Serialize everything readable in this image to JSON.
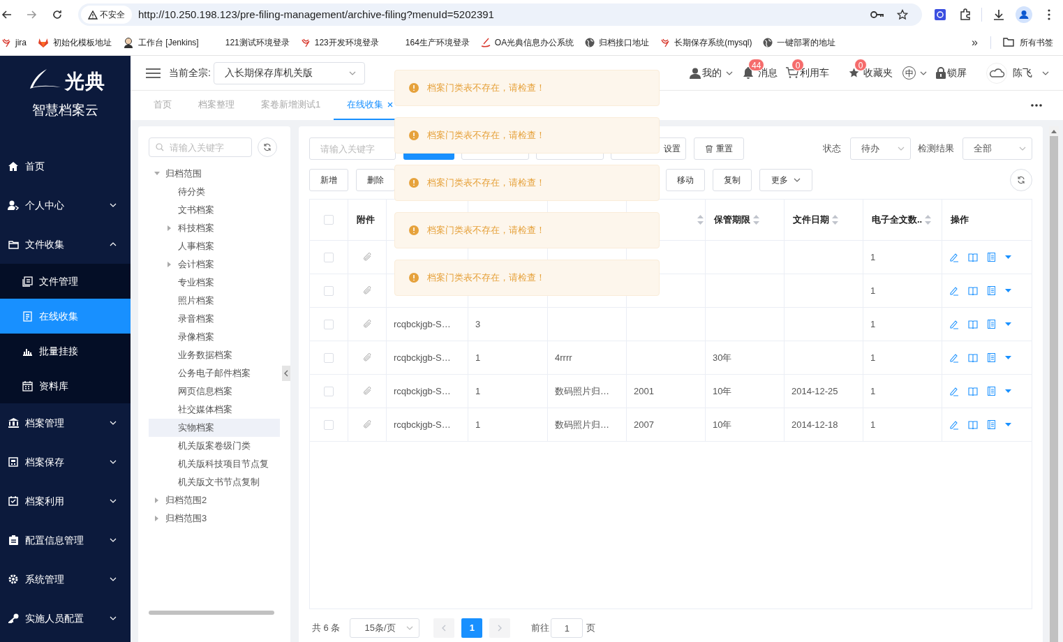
{
  "browser": {
    "security_label": "不安全",
    "url": "http://10.250.198.123/pre-filing-management/archive-filing?menuId=5202391",
    "bookmarks": [
      {
        "label": "jira"
      },
      {
        "label": "初始化模板地址"
      },
      {
        "label": "工作台 [Jenkins]"
      },
      {
        "label": "121测试环境登录"
      },
      {
        "label": "123开发环境登录"
      },
      {
        "label": "164生产环境登录"
      },
      {
        "label": "OA光典信息办公系统"
      },
      {
        "label": "归档接口地址"
      },
      {
        "label": "长期保存系统(mysql)"
      },
      {
        "label": "一键部署的地址"
      }
    ],
    "more": "»",
    "all_bookmarks": "所有书签"
  },
  "sidebar": {
    "logo_text": "光典",
    "subtitle": "智慧档案云",
    "menu": [
      {
        "label": "首页",
        "selected": false
      },
      {
        "label": "个人中心",
        "expanded": false,
        "selected": false
      },
      {
        "label": "文件收集",
        "expanded": true,
        "selected": false,
        "children": [
          {
            "label": "文件管理",
            "selected": false
          },
          {
            "label": "在线收集",
            "selected": true
          },
          {
            "label": "批量挂接",
            "selected": false
          },
          {
            "label": "资料库",
            "selected": false
          }
        ]
      },
      {
        "label": "档案管理",
        "expanded": false,
        "selected": false
      },
      {
        "label": "档案保存",
        "expanded": false,
        "selected": false
      },
      {
        "label": "档案利用",
        "expanded": false,
        "selected": false
      },
      {
        "label": "配置信息管理",
        "expanded": false,
        "selected": false
      },
      {
        "label": "系统管理",
        "expanded": false,
        "selected": false
      },
      {
        "label": "实施人员配置",
        "expanded": false,
        "selected": false
      }
    ]
  },
  "header": {
    "fonds_label": "当前全宗:",
    "fonds_value": "入长期保存库机关版",
    "items": [
      {
        "label": "我的"
      },
      {
        "label": "消息",
        "badge": "44"
      },
      {
        "label": "利用车",
        "badge": "0"
      },
      {
        "label": "收藏夹",
        "badge": "0"
      },
      {
        "label": "中"
      },
      {
        "label": "锁屏"
      }
    ],
    "user": "陈飞"
  },
  "tabs": [
    {
      "label": "首页",
      "selected": false
    },
    {
      "label": "档案整理",
      "selected": false
    },
    {
      "label": "案卷新增测试1",
      "selected": false
    },
    {
      "label": "在线收集",
      "selected": true,
      "closable": true
    }
  ],
  "tree": {
    "search_placeholder": "请输入关键字",
    "nodes": [
      {
        "label": "归档范围",
        "expanded": true,
        "selected": false,
        "children": [
          {
            "label": "待分类",
            "selected": false
          },
          {
            "label": "文书档案",
            "selected": false
          },
          {
            "label": "科技档案",
            "expanded": false,
            "selected": false
          },
          {
            "label": "人事档案",
            "selected": false
          },
          {
            "label": "会计档案",
            "expanded": false,
            "selected": false
          },
          {
            "label": "专业档案",
            "selected": false
          },
          {
            "label": "照片档案",
            "selected": false
          },
          {
            "label": "录音档案",
            "selected": false
          },
          {
            "label": "录像档案",
            "selected": false
          },
          {
            "label": "业务数据档案",
            "selected": false
          },
          {
            "label": "公务电子邮件档案",
            "selected": false
          },
          {
            "label": "网页信息档案",
            "selected": false
          },
          {
            "label": "社交媒体档案",
            "selected": false
          },
          {
            "label": "实物档案",
            "selected": true
          },
          {
            "label": "机关版案卷级门类",
            "selected": false
          },
          {
            "label": "机关版科技项目节点复",
            "selected": false
          },
          {
            "label": "机关版文书节点复制",
            "selected": false
          }
        ]
      },
      {
        "label": "归档范围2",
        "expanded": false,
        "selected": false
      },
      {
        "label": "归档范围3",
        "expanded": false,
        "selected": false
      }
    ]
  },
  "toolbar": {
    "search_placeholder": "请输入关键字",
    "settings_button": "设置",
    "reset_button": "重置",
    "status_label": "状态",
    "status_value": "待办",
    "result_label": "检测结果",
    "result_value": "全部",
    "actions": [
      "新增",
      "删除",
      "移动",
      "复制",
      "更多"
    ]
  },
  "table": {
    "all_checked": false,
    "columns": [
      {
        "label": "附件",
        "sortable": false
      },
      {
        "sortable": true
      },
      {
        "label": "保管期限",
        "sortable": true
      },
      {
        "label": "文件日期",
        "sortable": true
      },
      {
        "label": "电子全文数..",
        "sortable": true
      },
      {
        "label": "操作",
        "sortable": false
      }
    ],
    "rows": [
      {
        "checked": false,
        "full_text_count": "1"
      },
      {
        "checked": false,
        "full_text_count": "1"
      },
      {
        "checked": false,
        "column_3": "rcqbckjgb-S…",
        "column_4": "3",
        "full_text_count": "1"
      },
      {
        "checked": false,
        "column_3": "rcqbckjgb-S…",
        "column_4": "1",
        "column_5": "4rrrr",
        "retention_period": "30年",
        "full_text_count": "1"
      },
      {
        "checked": false,
        "column_3": "rcqbckjgb-S…",
        "column_4": "1",
        "column_5": "数码照片归…",
        "column_6": "2001",
        "retention_period": "10年",
        "file_date": "2014-12-25",
        "full_text_count": "1"
      },
      {
        "checked": false,
        "column_3": "rcqbckjgb-S…",
        "column_4": "1",
        "column_5": "数码照片归…",
        "column_6": "2007",
        "retention_period": "10年",
        "file_date": "2014-12-18",
        "full_text_count": "1"
      }
    ]
  },
  "pagination": {
    "total": "共 6 条",
    "page_size": "15条/页",
    "pages": [
      {
        "label": "1",
        "selected": true
      }
    ],
    "goto_label": "前往",
    "goto_value": "1",
    "page_unit": "页"
  },
  "messages": [
    {
      "text": "档案门类表不存在，请检查！"
    },
    {
      "text": "档案门类表不存在，请检查！"
    },
    {
      "text": "档案门类表不存在，请检查！"
    },
    {
      "text": "档案门类表不存在，请检查！"
    },
    {
      "text": "档案门类表不存在，请检查！"
    }
  ]
}
